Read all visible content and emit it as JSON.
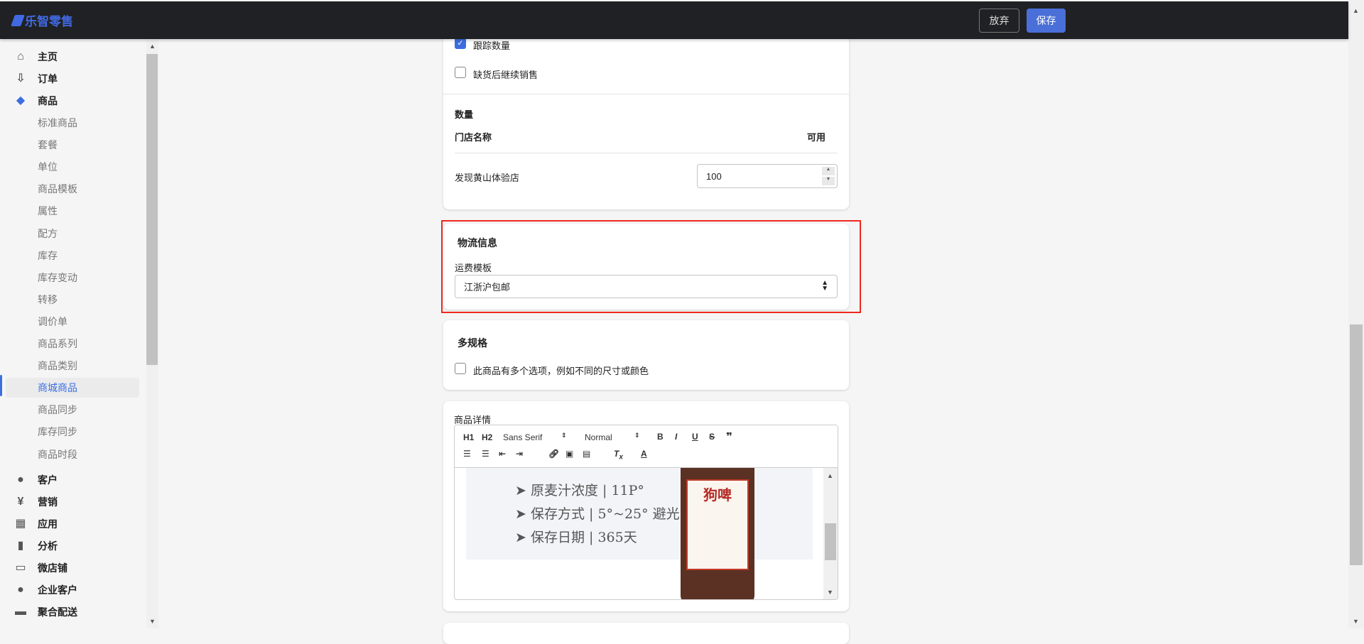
{
  "app": {
    "logo": "乐智零售",
    "discard": "放弃",
    "save": "保存"
  },
  "sidebar": {
    "main_top": [
      {
        "label": "主页",
        "icon": "home-icon"
      },
      {
        "label": "订单",
        "icon": "inbox-icon"
      },
      {
        "label": "商品",
        "icon": "tag-icon"
      }
    ],
    "sub": [
      "标准商品",
      "套餐",
      "单位",
      "商品模板",
      "属性",
      "配方",
      "库存",
      "库存变动",
      "转移",
      "调价单",
      "商品系列",
      "商品类别",
      "商城商品",
      "商品同步",
      "库存同步",
      "商品时段"
    ],
    "active": "商城商品",
    "main_bottom": [
      {
        "label": "客户",
        "icon": "person-icon"
      },
      {
        "label": "营销",
        "icon": "yen-receipt-icon"
      },
      {
        "label": "应用",
        "icon": "apps-icon"
      },
      {
        "label": "分析",
        "icon": "bar-chart-icon"
      },
      {
        "label": "微店铺",
        "icon": "store-icon"
      },
      {
        "label": "企业客户",
        "icon": "business-person-icon"
      },
      {
        "label": "聚合配送",
        "icon": "monitor-icon"
      }
    ]
  },
  "inventory": {
    "track_qty": "跟踪数量",
    "track_qty_checked": true,
    "continue_selling": "缺货后继续销售",
    "continue_selling_checked": false,
    "qty_title": "数量",
    "col_store": "门店名称",
    "col_available": "可用",
    "store": "发现黄山体验店",
    "qty": "100"
  },
  "logistics": {
    "title": "物流信息",
    "label": "运费模板",
    "value": "江浙沪包邮"
  },
  "variants": {
    "title": "多规格",
    "checkbox": "此商品有多个选项，例如不同的尺寸或颜色"
  },
  "details": {
    "label": "商品详情",
    "font": "Sans Serif",
    "size": "Normal",
    "h1": "H1",
    "h2": "H2",
    "specs": [
      "原麦汁浓度 | 11P°",
      "保存方式 | 5°~25° 避光",
      "保存日期 | 365天"
    ],
    "bottle_label": "狗啤"
  },
  "colors": {
    "accent": "#3d6ee0",
    "topbar": "#202124",
    "highlight": "#f0281e"
  }
}
